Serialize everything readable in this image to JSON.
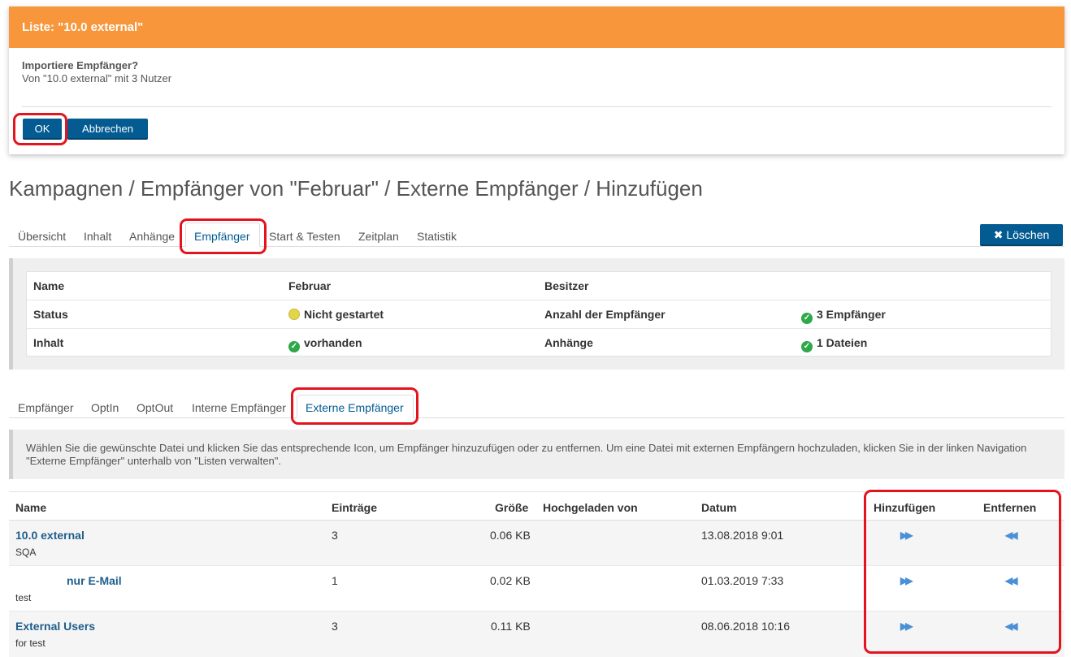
{
  "modal": {
    "title": "Liste: \"10.0 external\"",
    "question": "Importiere Empfänger?",
    "detail": "Von \"10.0 external\" mit 3 Nutzer",
    "ok_label": "OK",
    "cancel_label": "Abbrechen"
  },
  "breadcrumb": "Kampagnen / Empfänger von \"Februar\" / Externe Empfänger / Hinzufügen",
  "main_tabs": [
    "Übersicht",
    "Inhalt",
    "Anhänge",
    "Empfänger",
    "Start & Testen",
    "Zeitplan",
    "Statistik"
  ],
  "delete_label": "Löschen",
  "info": {
    "name_label": "Name",
    "name_value": "Februar",
    "owner_label": "Besitzer",
    "owner_value": "",
    "status_label": "Status",
    "status_value": "Nicht gestartet",
    "count_label": "Anzahl der Empfänger",
    "count_value": "3 Empfänger",
    "content_label": "Inhalt",
    "content_value": "vorhanden",
    "attach_label": "Anhänge",
    "attach_value": "1 Dateien"
  },
  "sub_tabs": [
    "Empfänger",
    "OptIn",
    "OptOut",
    "Interne Empfänger",
    "Externe Empfänger"
  ],
  "hint": "Wählen Sie die gewünschte Datei und klicken Sie das entsprechende Icon, um Empfänger hinzuzufügen oder zu entfernen. Um eine Datei mit externen Empfängern hochzuladen, klicken Sie in der linken Navigation \"Externe Empfänger\" unterhalb von \"Listen verwalten\".",
  "table": {
    "headers": {
      "name": "Name",
      "entries": "Einträge",
      "size": "Größe",
      "uploaded": "Hochgeladen von",
      "date": "Datum",
      "add": "Hinzufügen",
      "remove": "Entfernen"
    },
    "rows": [
      {
        "name": "10.0 external",
        "desc": "SQA",
        "entries": "3",
        "size": "0.06 KB",
        "uploaded": "",
        "date": "13.08.2018 9:01"
      },
      {
        "name": "nur E-Mail",
        "desc": "test",
        "entries": "1",
        "size": "0.02 KB",
        "uploaded": "",
        "date": "01.03.2019 7:33"
      },
      {
        "name": "External Users",
        "desc": "for test",
        "entries": "3",
        "size": "0.11 KB",
        "uploaded": "",
        "date": "08.06.2018 10:16"
      }
    ]
  },
  "icons": {
    "add": "fast-forward-icon",
    "remove": "rewind-icon",
    "status": "yellow-dot-icon",
    "ok": "check-circle-icon",
    "delete": "x-icon"
  },
  "colors": {
    "header_orange": "#f7963b",
    "primary_blue": "#035b91",
    "highlight_red": "#e3141e",
    "success_green": "#2ea84a"
  }
}
